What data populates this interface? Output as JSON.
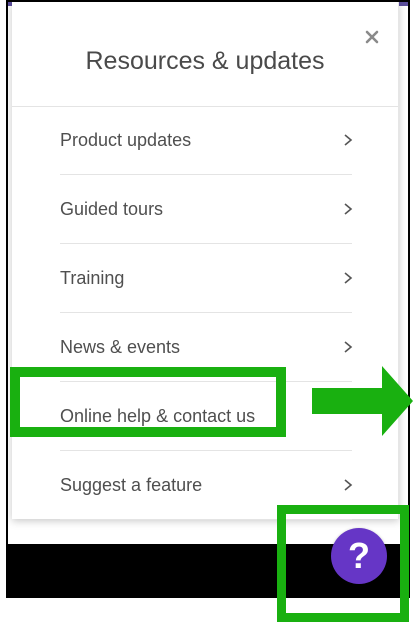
{
  "panel": {
    "title": "Resources & updates",
    "close_icon": "close-icon",
    "items": [
      {
        "label": "Product updates",
        "has_chevron": true
      },
      {
        "label": "Guided tours",
        "has_chevron": true
      },
      {
        "label": "Training",
        "has_chevron": true
      },
      {
        "label": "News & events",
        "has_chevron": true
      },
      {
        "label": "Online help & contact us",
        "has_chevron": false
      },
      {
        "label": "Suggest a feature",
        "has_chevron": true
      }
    ]
  },
  "help_button": {
    "glyph": "?",
    "icon": "help-question-icon"
  },
  "annotations": {
    "highlight_color": "#19b010",
    "arrow_icon": "right-arrow-icon"
  },
  "colors": {
    "accent_top": "#5b4e9c",
    "help_button": "#6636c6",
    "text": "#4f4f4f",
    "divider": "#e4e4e4"
  }
}
